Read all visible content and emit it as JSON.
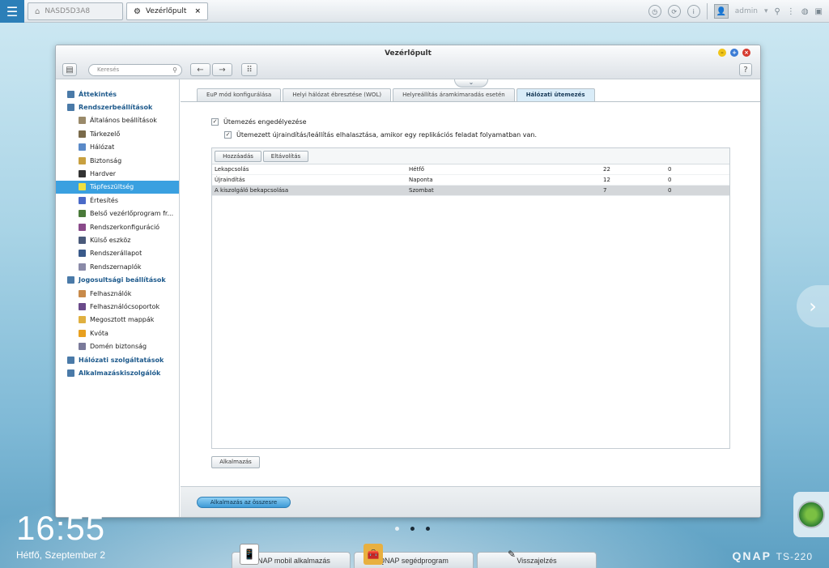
{
  "topbar": {
    "nas_name": "NASD5D3A8",
    "active_tab": "Vezérlőpult",
    "close_glyph": "×",
    "user": "admin"
  },
  "window": {
    "title": "Vezérlőpult",
    "search_placeholder": "Keresés",
    "help_label": "?"
  },
  "sidebar": {
    "items": [
      {
        "label": "Áttekintés",
        "type": "group",
        "icon": "overview-icon",
        "color": "#4a7aa8"
      },
      {
        "label": "Rendszerbeállítások",
        "type": "group",
        "icon": "gear-icon",
        "color": "#4a7aa8"
      },
      {
        "label": "Általános beállítások",
        "type": "item",
        "icon": "general-settings-icon",
        "color": "#9a8a6a"
      },
      {
        "label": "Tárkezelő",
        "type": "item",
        "icon": "storage-icon",
        "color": "#7a6a4a"
      },
      {
        "label": "Hálózat",
        "type": "item",
        "icon": "network-icon",
        "color": "#5a8ac8"
      },
      {
        "label": "Biztonság",
        "type": "item",
        "icon": "lock-icon",
        "color": "#c8a040"
      },
      {
        "label": "Hardver",
        "type": "item",
        "icon": "hardware-icon",
        "color": "#333333"
      },
      {
        "label": "Tápfeszültség",
        "type": "item",
        "icon": "power-icon",
        "color": "#f0e040",
        "active": true
      },
      {
        "label": "Értesítés",
        "type": "item",
        "icon": "notification-icon",
        "color": "#4a6ac8"
      },
      {
        "label": "Belső vezérlőprogram fr...",
        "type": "item",
        "icon": "firmware-icon",
        "color": "#4a7a3a"
      },
      {
        "label": "Rendszerkonfiguráció",
        "type": "item",
        "icon": "sysconfig-icon",
        "color": "#8a4a8a"
      },
      {
        "label": "Külső eszköz",
        "type": "item",
        "icon": "external-device-icon",
        "color": "#4a5a7a"
      },
      {
        "label": "Rendszerállapot",
        "type": "item",
        "icon": "system-status-icon",
        "color": "#3a5a8a"
      },
      {
        "label": "Rendszernaplók",
        "type": "item",
        "icon": "logs-icon",
        "color": "#8a8aa8"
      },
      {
        "label": "Jogosultsági beállítások",
        "type": "group",
        "icon": "user-icon",
        "color": "#4a7aa8"
      },
      {
        "label": "Felhasználók",
        "type": "item",
        "icon": "users-icon",
        "color": "#c88a4a"
      },
      {
        "label": "Felhasználócsoportok",
        "type": "item",
        "icon": "user-groups-icon",
        "color": "#6a4a8a"
      },
      {
        "label": "Megosztott mappák",
        "type": "item",
        "icon": "shared-folder-icon",
        "color": "#e0b040"
      },
      {
        "label": "Kvóta",
        "type": "item",
        "icon": "quota-icon",
        "color": "#e8a020"
      },
      {
        "label": "Domén biztonság",
        "type": "item",
        "icon": "domain-security-icon",
        "color": "#7a7a9a"
      },
      {
        "label": "Hálózati szolgáltatások",
        "type": "group",
        "icon": "network-services-icon",
        "color": "#4a7aa8"
      },
      {
        "label": "Alkalmazáskiszolgálók",
        "type": "group",
        "icon": "app-server-icon",
        "color": "#4a7aa8"
      }
    ]
  },
  "tabs": [
    {
      "label": "EuP mód konfigurálása"
    },
    {
      "label": "Helyi hálózat ébresztése (WOL)"
    },
    {
      "label": "Helyreállítás áramkimaradás esetén"
    },
    {
      "label": "Hálózati ütemezés",
      "active": true
    }
  ],
  "schedule": {
    "enable_label": "Ütemezés engedélyezése",
    "enable_checked": true,
    "postpone_label": "Ütemezett újraindítás/leállítás elhalasztása, amikor egy replikációs feladat folyamatban van.",
    "postpone_checked": true,
    "add_button": "Hozzáadás",
    "remove_button": "Eltávolítás",
    "rows": [
      {
        "action": "Lekapcsolás",
        "day": "Hétfő",
        "hour": "22",
        "minute": "0"
      },
      {
        "action": "Újraindítás",
        "day": "Naponta",
        "hour": "12",
        "minute": "0"
      },
      {
        "action": "A kiszolgáló bekapcsolása",
        "day": "Szombat",
        "hour": "7",
        "minute": "0",
        "selected": true
      }
    ],
    "apply_button": "Alkalmazás",
    "apply_all_button": "Alkalmazás az összesre"
  },
  "desktop": {
    "time": "16:55",
    "date": "Hétfő, Szeptember 2",
    "dock": [
      {
        "label": "QNAP mobil alkalmazás",
        "icon": "mobile-app-icon"
      },
      {
        "label": "QNAP segédprogram",
        "icon": "utility-icon"
      },
      {
        "label": "Visszajelzés",
        "icon": "feedback-icon"
      }
    ],
    "brand": "QNAP",
    "model": "TS-220"
  }
}
